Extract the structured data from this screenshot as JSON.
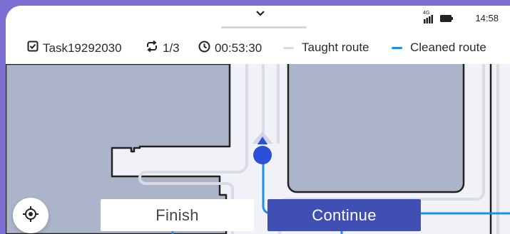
{
  "status_bar": {
    "signal": "4G",
    "time": "14:58"
  },
  "task_bar": {
    "task_name": "Task19292030",
    "loop": "1/3",
    "elapsed": "00:53:30",
    "legend": [
      {
        "label": "Taught route",
        "color": "#d9dbe3"
      },
      {
        "label": "Cleaned route",
        "color": "#1e8fe6"
      }
    ]
  },
  "actions": {
    "finish_label": "Finish",
    "continue_label": "Continue"
  },
  "colors": {
    "accent": "#3f4fb4",
    "obstacle": "#acb4c9",
    "cleaned_route": "#1e8fe6",
    "taught_route": "#d9dbe3",
    "robot": "#2d4ed8"
  },
  "icons": [
    "chevron-down-icon",
    "signal-icon",
    "battery-icon",
    "checkbox-icon",
    "loop-icon",
    "clock-icon",
    "locate-icon",
    "robot-icon"
  ]
}
